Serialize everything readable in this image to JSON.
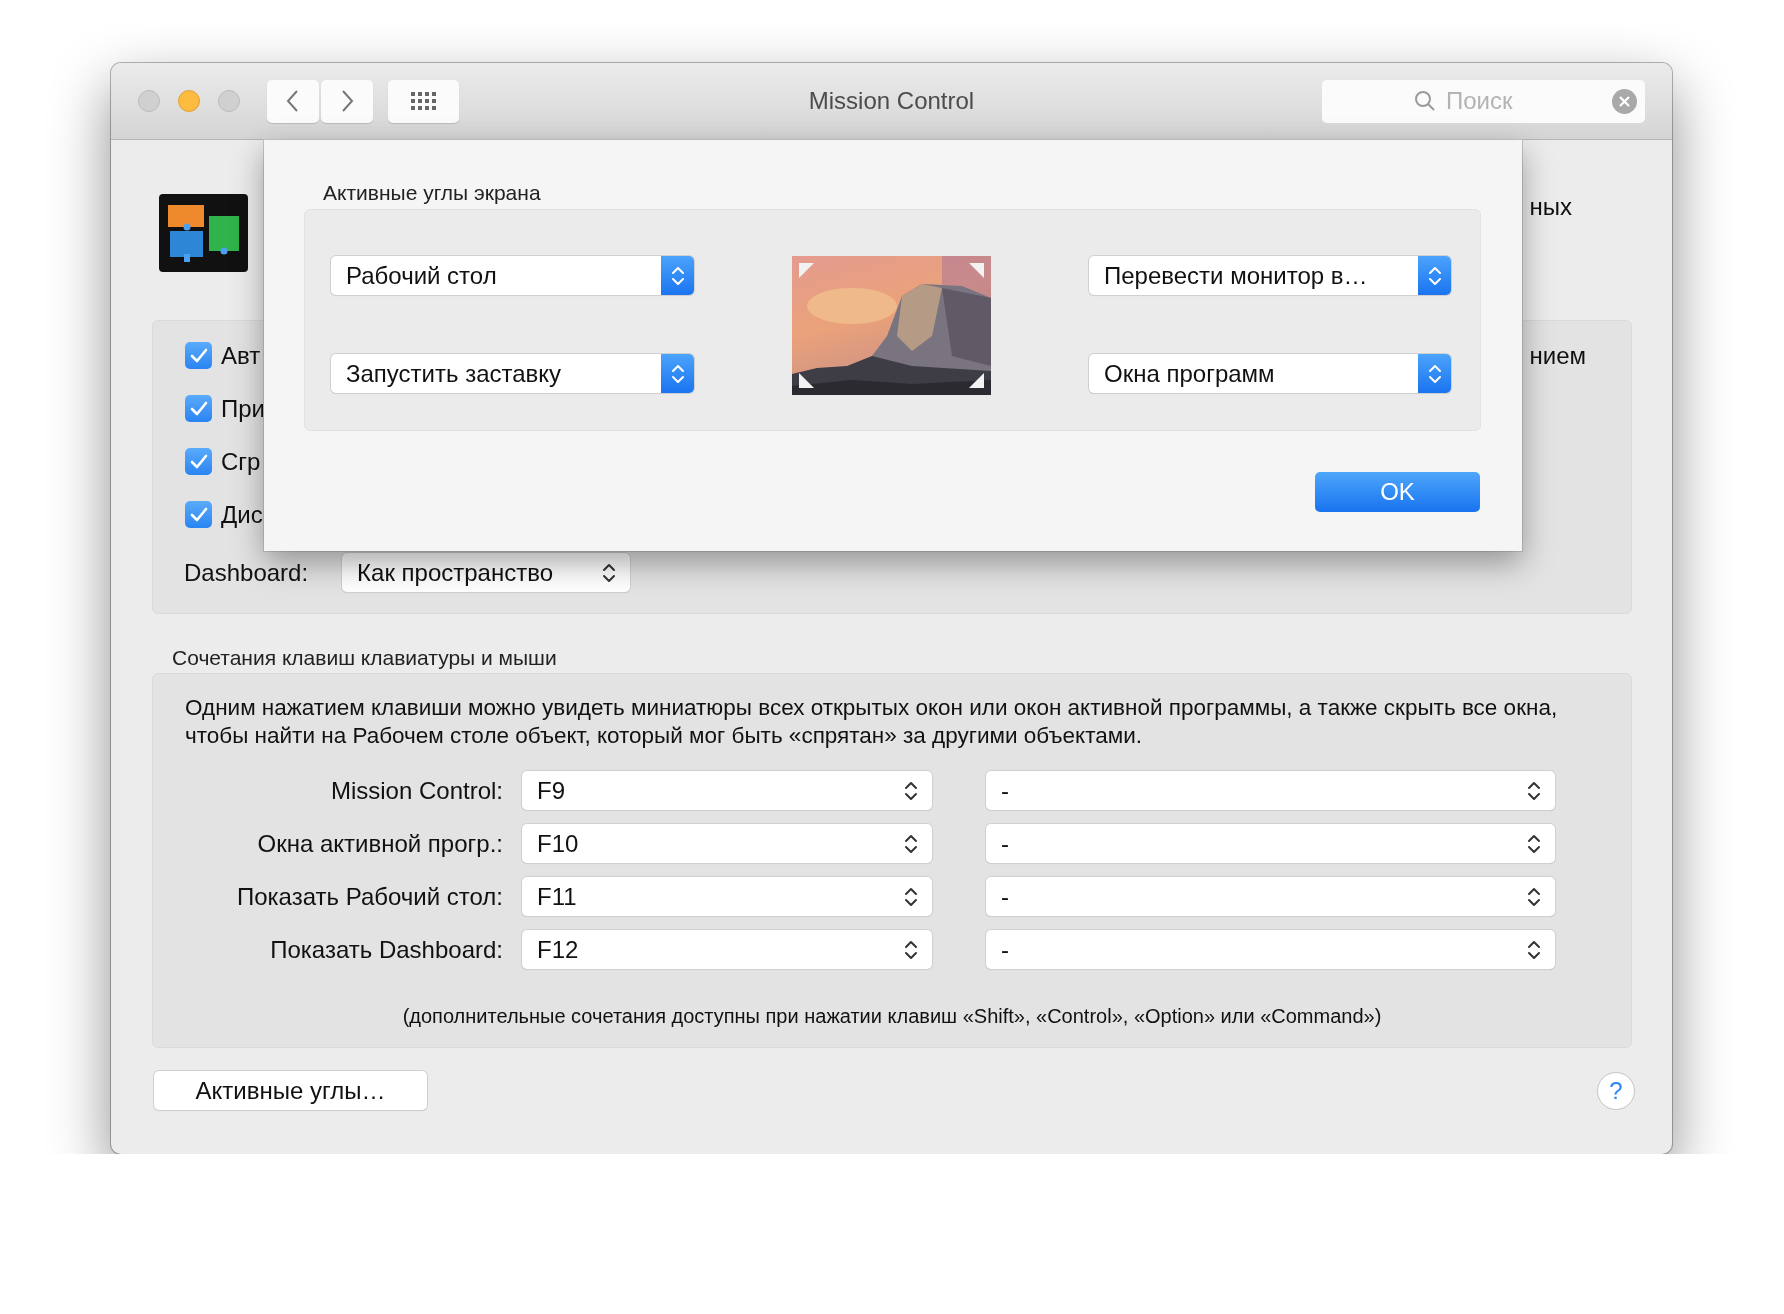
{
  "window": {
    "title": "Mission Control",
    "traffic_lights": [
      {
        "active": false
      },
      {
        "active": true
      },
      {
        "active": false
      }
    ]
  },
  "search": {
    "placeholder": "Поиск"
  },
  "preferences": {
    "header_fragment": "ных",
    "options": [
      {
        "label": "Авт",
        "checked": true,
        "trailing": "нием"
      },
      {
        "label": "При",
        "checked": true
      },
      {
        "label": "Сгр",
        "checked": true
      },
      {
        "label": "Дис",
        "checked": true
      }
    ],
    "dashboard": {
      "label": "Dashboard:",
      "value": "Как пространство"
    }
  },
  "shortcuts": {
    "title": "Сочетания клавиш клавиатуры и мыши",
    "description": "Одним нажатием клавиши можно увидеть миниатюры всех открытых окон или окон активной программы, а также скрыть все окна, чтобы найти на Рабочем столе объект, который мог быть «спрятан» за другими объектами.",
    "rows": [
      {
        "label": "Mission Control:",
        "key": "F9",
        "modifier": "-"
      },
      {
        "label": "Окна активной прогр.:",
        "key": "F10",
        "modifier": "-"
      },
      {
        "label": "Показать Рабочий стол:",
        "key": "F11",
        "modifier": "-"
      },
      {
        "label": "Показать Dashboard:",
        "key": "F12",
        "modifier": "-"
      }
    ],
    "note": "(дополнительные сочетания доступны при нажатии клавиш «Shift», «Control», «Option» или «Command»)"
  },
  "hot_corners_button": "Активные углы…",
  "help_button": "?",
  "sheet": {
    "title": "Активные углы экрана",
    "corners": {
      "top_left": "Рабочий стол",
      "bottom_left": "Запустить заставку",
      "top_right": "Перевести монитор в…",
      "bottom_right": "Окна программ"
    },
    "ok_button": "OK"
  }
}
